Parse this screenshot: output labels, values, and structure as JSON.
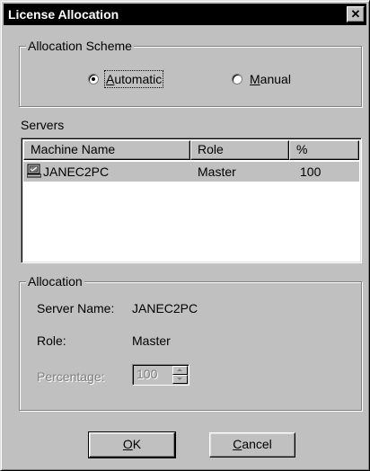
{
  "window": {
    "title": "License Allocation",
    "close_glyph": "✕"
  },
  "allocation_scheme": {
    "legend": "Allocation Scheme",
    "options": [
      {
        "label": "Automatic",
        "mnemonic": "A",
        "rest": "utomatic",
        "selected": true
      },
      {
        "label": "Manual",
        "mnemonic": "M",
        "rest": "anual",
        "selected": false
      }
    ]
  },
  "servers": {
    "label": "Servers",
    "columns": [
      "Machine Name",
      "Role",
      "%"
    ],
    "rows": [
      {
        "machine": "JANEC2PC",
        "role": "Master",
        "percent": "100",
        "icon": "computer-icon",
        "selected": true
      }
    ]
  },
  "allocation": {
    "legend": "Allocation",
    "server_name_label": "Server Name:",
    "server_name_value": "JANEC2PC",
    "role_label": "Role:",
    "role_value": "Master",
    "percentage_label": "Percentage:",
    "percentage_value": "100"
  },
  "buttons": {
    "ok": {
      "label": "OK",
      "mnemonic": "O",
      "rest": "K"
    },
    "cancel": {
      "label": "Cancel",
      "mnemonic": "C",
      "rest": "ancel"
    }
  },
  "colors": {
    "face": "#c0c0c0",
    "titlebar": "#000000",
    "highlight_row": "#c0c0c0"
  }
}
